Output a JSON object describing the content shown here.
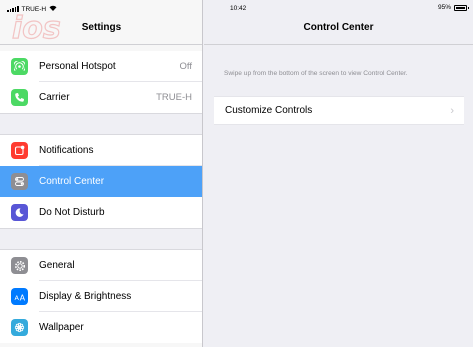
{
  "status": {
    "carrier": "TRUE-H",
    "time": "10:42",
    "battery": "95%"
  },
  "sidebar": {
    "title": "Settings",
    "items": [
      {
        "label": "Personal Hotspot",
        "value": "Off",
        "icon": "personal-hotspot-icon",
        "color": "#4cd964"
      },
      {
        "label": "Carrier",
        "value": "TRUE-H",
        "icon": "phone-icon",
        "color": "#4cd964"
      },
      {
        "label": "Notifications",
        "value": "",
        "icon": "notifications-icon",
        "color": "#ff3b30"
      },
      {
        "label": "Control Center",
        "value": "",
        "icon": "control-center-icon",
        "color": "#8e8e93",
        "selected": true
      },
      {
        "label": "Do Not Disturb",
        "value": "",
        "icon": "moon-icon",
        "color": "#5856d6"
      },
      {
        "label": "General",
        "value": "",
        "icon": "gear-icon",
        "color": "#8e8e93"
      },
      {
        "label": "Display & Brightness",
        "value": "",
        "icon": "display-brightness-icon",
        "color": "#007aff"
      },
      {
        "label": "Wallpaper",
        "value": "",
        "icon": "wallpaper-icon",
        "color": "#34aadc"
      }
    ]
  },
  "detail": {
    "title": "Control Center",
    "hint": "Swipe up from the bottom of the screen to view Control Center.",
    "row_label": "Customize Controls"
  },
  "colors": {
    "selected_row": "#4da1f8",
    "background": "#efeff4"
  }
}
